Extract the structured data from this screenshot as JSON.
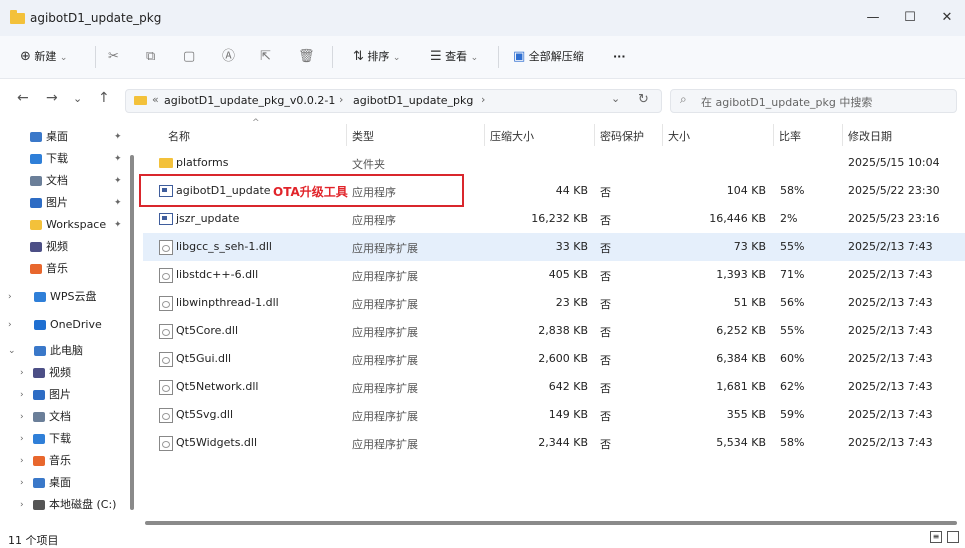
{
  "window": {
    "title": "agibotD1_update_pkg",
    "controls": {
      "minimize": "—",
      "maximize": "☐",
      "close": "✕"
    }
  },
  "toolbar": {
    "new_label": "新建",
    "sort_label": "排序",
    "view_label": "查看",
    "extract_label": "全部解压缩",
    "more_label": "···"
  },
  "address": {
    "prefix": "«",
    "path": [
      "agibotD1_update_pkg_v0.0.2-1",
      "agibotD1_update_pkg"
    ],
    "separator": "›",
    "search_placeholder": "在 agibotD1_update_pkg 中搜索"
  },
  "nav": {
    "items": [
      {
        "label": "桌面",
        "color": "#3a78c9",
        "pinned": true,
        "chev": ""
      },
      {
        "label": "下载",
        "color": "#2f7fd8",
        "pinned": true,
        "chev": ""
      },
      {
        "label": "文档",
        "color": "#6b7f99",
        "pinned": true,
        "chev": ""
      },
      {
        "label": "图片",
        "color": "#2d6cc4",
        "pinned": true,
        "chev": ""
      },
      {
        "label": "Workspace",
        "color": "#f3c13a",
        "pinned": true,
        "chev": ""
      },
      {
        "label": "视频",
        "color": "#4c4f86",
        "pinned": false,
        "chev": ""
      },
      {
        "label": "音乐",
        "color": "#e8672d",
        "pinned": false,
        "chev": ""
      },
      {
        "label": "WPS云盘",
        "color": "#2f7fd8",
        "pinned": false,
        "chev": "›"
      },
      {
        "label": "OneDrive",
        "color": "#1f6fd1",
        "pinned": false,
        "chev": "›"
      },
      {
        "label": "此电脑",
        "color": "#3a78c9",
        "pinned": false,
        "chev": "⌄"
      },
      {
        "label": "视频",
        "color": "#4c4f86",
        "pinned": false,
        "chev": "›"
      },
      {
        "label": "图片",
        "color": "#2d6cc4",
        "pinned": false,
        "chev": "›"
      },
      {
        "label": "文档",
        "color": "#6b7f99",
        "pinned": false,
        "chev": "›"
      },
      {
        "label": "下载",
        "color": "#2f7fd8",
        "pinned": false,
        "chev": "›"
      },
      {
        "label": "音乐",
        "color": "#e8672d",
        "pinned": false,
        "chev": "›"
      },
      {
        "label": "桌面",
        "color": "#3a78c9",
        "pinned": false,
        "chev": "›"
      },
      {
        "label": "本地磁盘 (C:)",
        "color": "#555555",
        "pinned": false,
        "chev": "›"
      }
    ]
  },
  "columns": {
    "name": "名称",
    "type": "类型",
    "packed_size": "压缩大小",
    "password": "密码保护",
    "size": "大小",
    "ratio": "比率",
    "modified": "修改日期"
  },
  "files": [
    {
      "name": "platforms",
      "type": "文件夹",
      "packed": "",
      "password": "",
      "size": "",
      "ratio": "",
      "date": "2025/5/15 10:04",
      "kind": "folder"
    },
    {
      "name": "agibotD1_update",
      "type": "应用程序",
      "packed": "44 KB",
      "password": "否",
      "size": "104 KB",
      "ratio": "58%",
      "date": "2025/5/22 23:30",
      "kind": "app"
    },
    {
      "name": "jszr_update",
      "type": "应用程序",
      "packed": "16,232 KB",
      "password": "否",
      "size": "16,446 KB",
      "ratio": "2%",
      "date": "2025/5/23 23:16",
      "kind": "app"
    },
    {
      "name": "libgcc_s_seh-1.dll",
      "type": "应用程序扩展",
      "packed": "33 KB",
      "password": "否",
      "size": "73 KB",
      "ratio": "55%",
      "date": "2025/2/13 7:43",
      "kind": "dll"
    },
    {
      "name": "libstdc++-6.dll",
      "type": "应用程序扩展",
      "packed": "405 KB",
      "password": "否",
      "size": "1,393 KB",
      "ratio": "71%",
      "date": "2025/2/13 7:43",
      "kind": "dll"
    },
    {
      "name": "libwinpthread-1.dll",
      "type": "应用程序扩展",
      "packed": "23 KB",
      "password": "否",
      "size": "51 KB",
      "ratio": "56%",
      "date": "2025/2/13 7:43",
      "kind": "dll"
    },
    {
      "name": "Qt5Core.dll",
      "type": "应用程序扩展",
      "packed": "2,838 KB",
      "password": "否",
      "size": "6,252 KB",
      "ratio": "55%",
      "date": "2025/2/13 7:43",
      "kind": "dll"
    },
    {
      "name": "Qt5Gui.dll",
      "type": "应用程序扩展",
      "packed": "2,600 KB",
      "password": "否",
      "size": "6,384 KB",
      "ratio": "60%",
      "date": "2025/2/13 7:43",
      "kind": "dll"
    },
    {
      "name": "Qt5Network.dll",
      "type": "应用程序扩展",
      "packed": "642 KB",
      "password": "否",
      "size": "1,681 KB",
      "ratio": "62%",
      "date": "2025/2/13 7:43",
      "kind": "dll"
    },
    {
      "name": "Qt5Svg.dll",
      "type": "应用程序扩展",
      "packed": "149 KB",
      "password": "否",
      "size": "355 KB",
      "ratio": "59%",
      "date": "2025/2/13 7:43",
      "kind": "dll"
    },
    {
      "name": "Qt5Widgets.dll",
      "type": "应用程序扩展",
      "packed": "2,344 KB",
      "password": "否",
      "size": "5,534 KB",
      "ratio": "58%",
      "date": "2025/2/13 7:43",
      "kind": "dll"
    }
  ],
  "selected_row": 3,
  "annotation": {
    "text": "OTA升级工具",
    "color": "#e1242a"
  },
  "status": {
    "item_count": "11 个项目"
  }
}
